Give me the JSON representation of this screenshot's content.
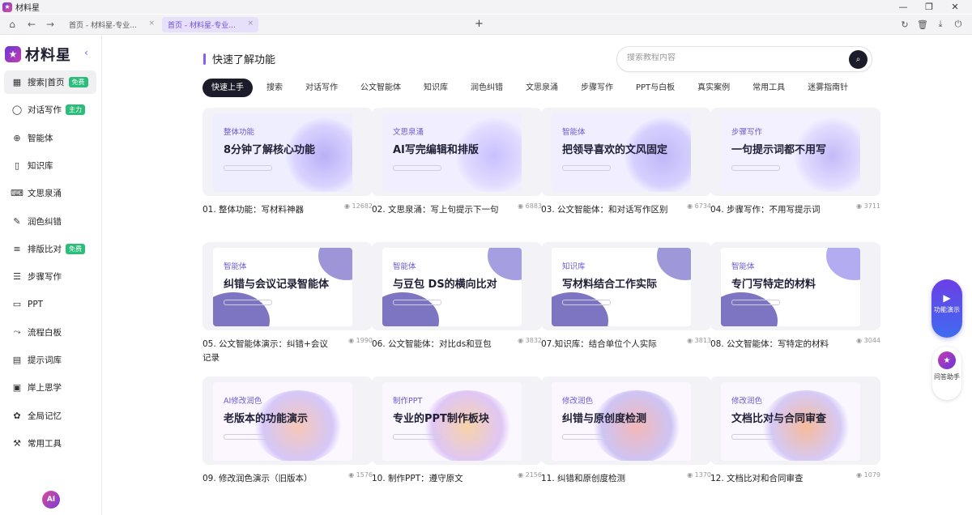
{
  "window": {
    "title": "材料星",
    "controls": [
      "—",
      "❐",
      "✕"
    ]
  },
  "tabs": [
    {
      "label": "首页 - 材料星-专业...",
      "close": "×",
      "active": false
    },
    {
      "label": "首页 - 材料星-专业...",
      "close": "×",
      "active": true
    }
  ],
  "newtab": "+",
  "sidebar": {
    "logo_text": "材料星",
    "collapse": "‹",
    "items": [
      {
        "label": "搜索|首页",
        "badge": "免费",
        "icon": "grid-icon"
      },
      {
        "label": "对话写作",
        "badge": "主力",
        "icon": "chat-icon"
      },
      {
        "label": "智能体",
        "badge": "",
        "icon": "agent-icon"
      },
      {
        "label": "知识库",
        "badge": "",
        "icon": "book-icon"
      },
      {
        "label": "文思泉涌",
        "badge": "",
        "icon": "keyboard-icon"
      },
      {
        "label": "润色纠错",
        "badge": "",
        "icon": "pen-icon"
      },
      {
        "label": "排版比对",
        "badge": "免费",
        "icon": "lines-icon"
      },
      {
        "label": "步骤写作",
        "badge": "",
        "icon": "list-icon"
      },
      {
        "label": "PPT",
        "badge": "",
        "icon": "presentation-icon"
      },
      {
        "label": "流程白板",
        "badge": "",
        "icon": "flow-icon"
      },
      {
        "label": "提示词库",
        "badge": "",
        "icon": "document-icon"
      },
      {
        "label": "岸上思学",
        "badge": "",
        "icon": "video-icon"
      },
      {
        "label": "全局记忆",
        "badge": "",
        "icon": "memory-icon"
      },
      {
        "label": "常用工具",
        "badge": "",
        "icon": "wrench-icon"
      }
    ]
  },
  "main": {
    "heading": "快速了解功能",
    "search_placeholder": "搜索教程内容",
    "filters": [
      "快速上手",
      "搜索",
      "对话写作",
      "公文智能体",
      "知识库",
      "润色纠错",
      "文思泉涌",
      "步骤写作",
      "PPT与白板",
      "真实案例",
      "常用工具",
      "迷雾指南针"
    ],
    "cards": [
      {
        "tag": "整体功能",
        "title": "8分钟了解核心功能",
        "caption": "01. 整体功能：写材料神器",
        "views": "12682"
      },
      {
        "tag": "文思泉涌",
        "title": "AI写完编辑和排版",
        "caption": "02. 文思泉涌：写上句提示下一句",
        "views": "6883"
      },
      {
        "tag": "智能体",
        "title": "把领导喜欢的文风固定",
        "caption": "03. 公文智能体：和对话写作区别",
        "views": "6734"
      },
      {
        "tag": "步骤写作",
        "title": "一句提示词都不用写",
        "caption": "04. 步骤写作：不用写提示词",
        "views": "3711"
      },
      {
        "tag": "智能体",
        "title": "纠错与会议记录智能体",
        "caption": "05. 公文智能体演示：纠错+会议记录",
        "views": "1990"
      },
      {
        "tag": "智能体",
        "title": "与豆包 DS的横向比对",
        "caption": "06. 公文智能体：对比ds和豆包",
        "views": "3832"
      },
      {
        "tag": "知识库",
        "title": "写材料结合工作实际",
        "caption": "07.知识库：结合单位个人实际",
        "views": "3813"
      },
      {
        "tag": "智能体",
        "title": "专门写特定的材料",
        "caption": "08. 公文智能体：写特定的材料",
        "views": "3044"
      },
      {
        "tag": "AI修改润色",
        "title": "老版本的功能演示",
        "caption": "09. 修改润色演示（旧版本）",
        "views": "1576"
      },
      {
        "tag": "制作PPT",
        "title": "专业的PPT制作板块",
        "caption": "10. 制作PPT：遵守原文",
        "views": "2156"
      },
      {
        "tag": "修改润色",
        "title": "纠错与原创度检测",
        "caption": "11. 纠错和原创度检测",
        "views": "1370"
      },
      {
        "tag": "修改润色",
        "title": "文档比对与合同审查",
        "caption": "12. 文档比对和合同审查",
        "views": "1079"
      }
    ]
  },
  "floating": {
    "demo_label": "功能演示",
    "assistant_label": "问答助手"
  },
  "colors": {
    "accent": "#8a5cf0",
    "badge_green": "#2dbd7b",
    "chip_active": "#1b1b2a"
  }
}
